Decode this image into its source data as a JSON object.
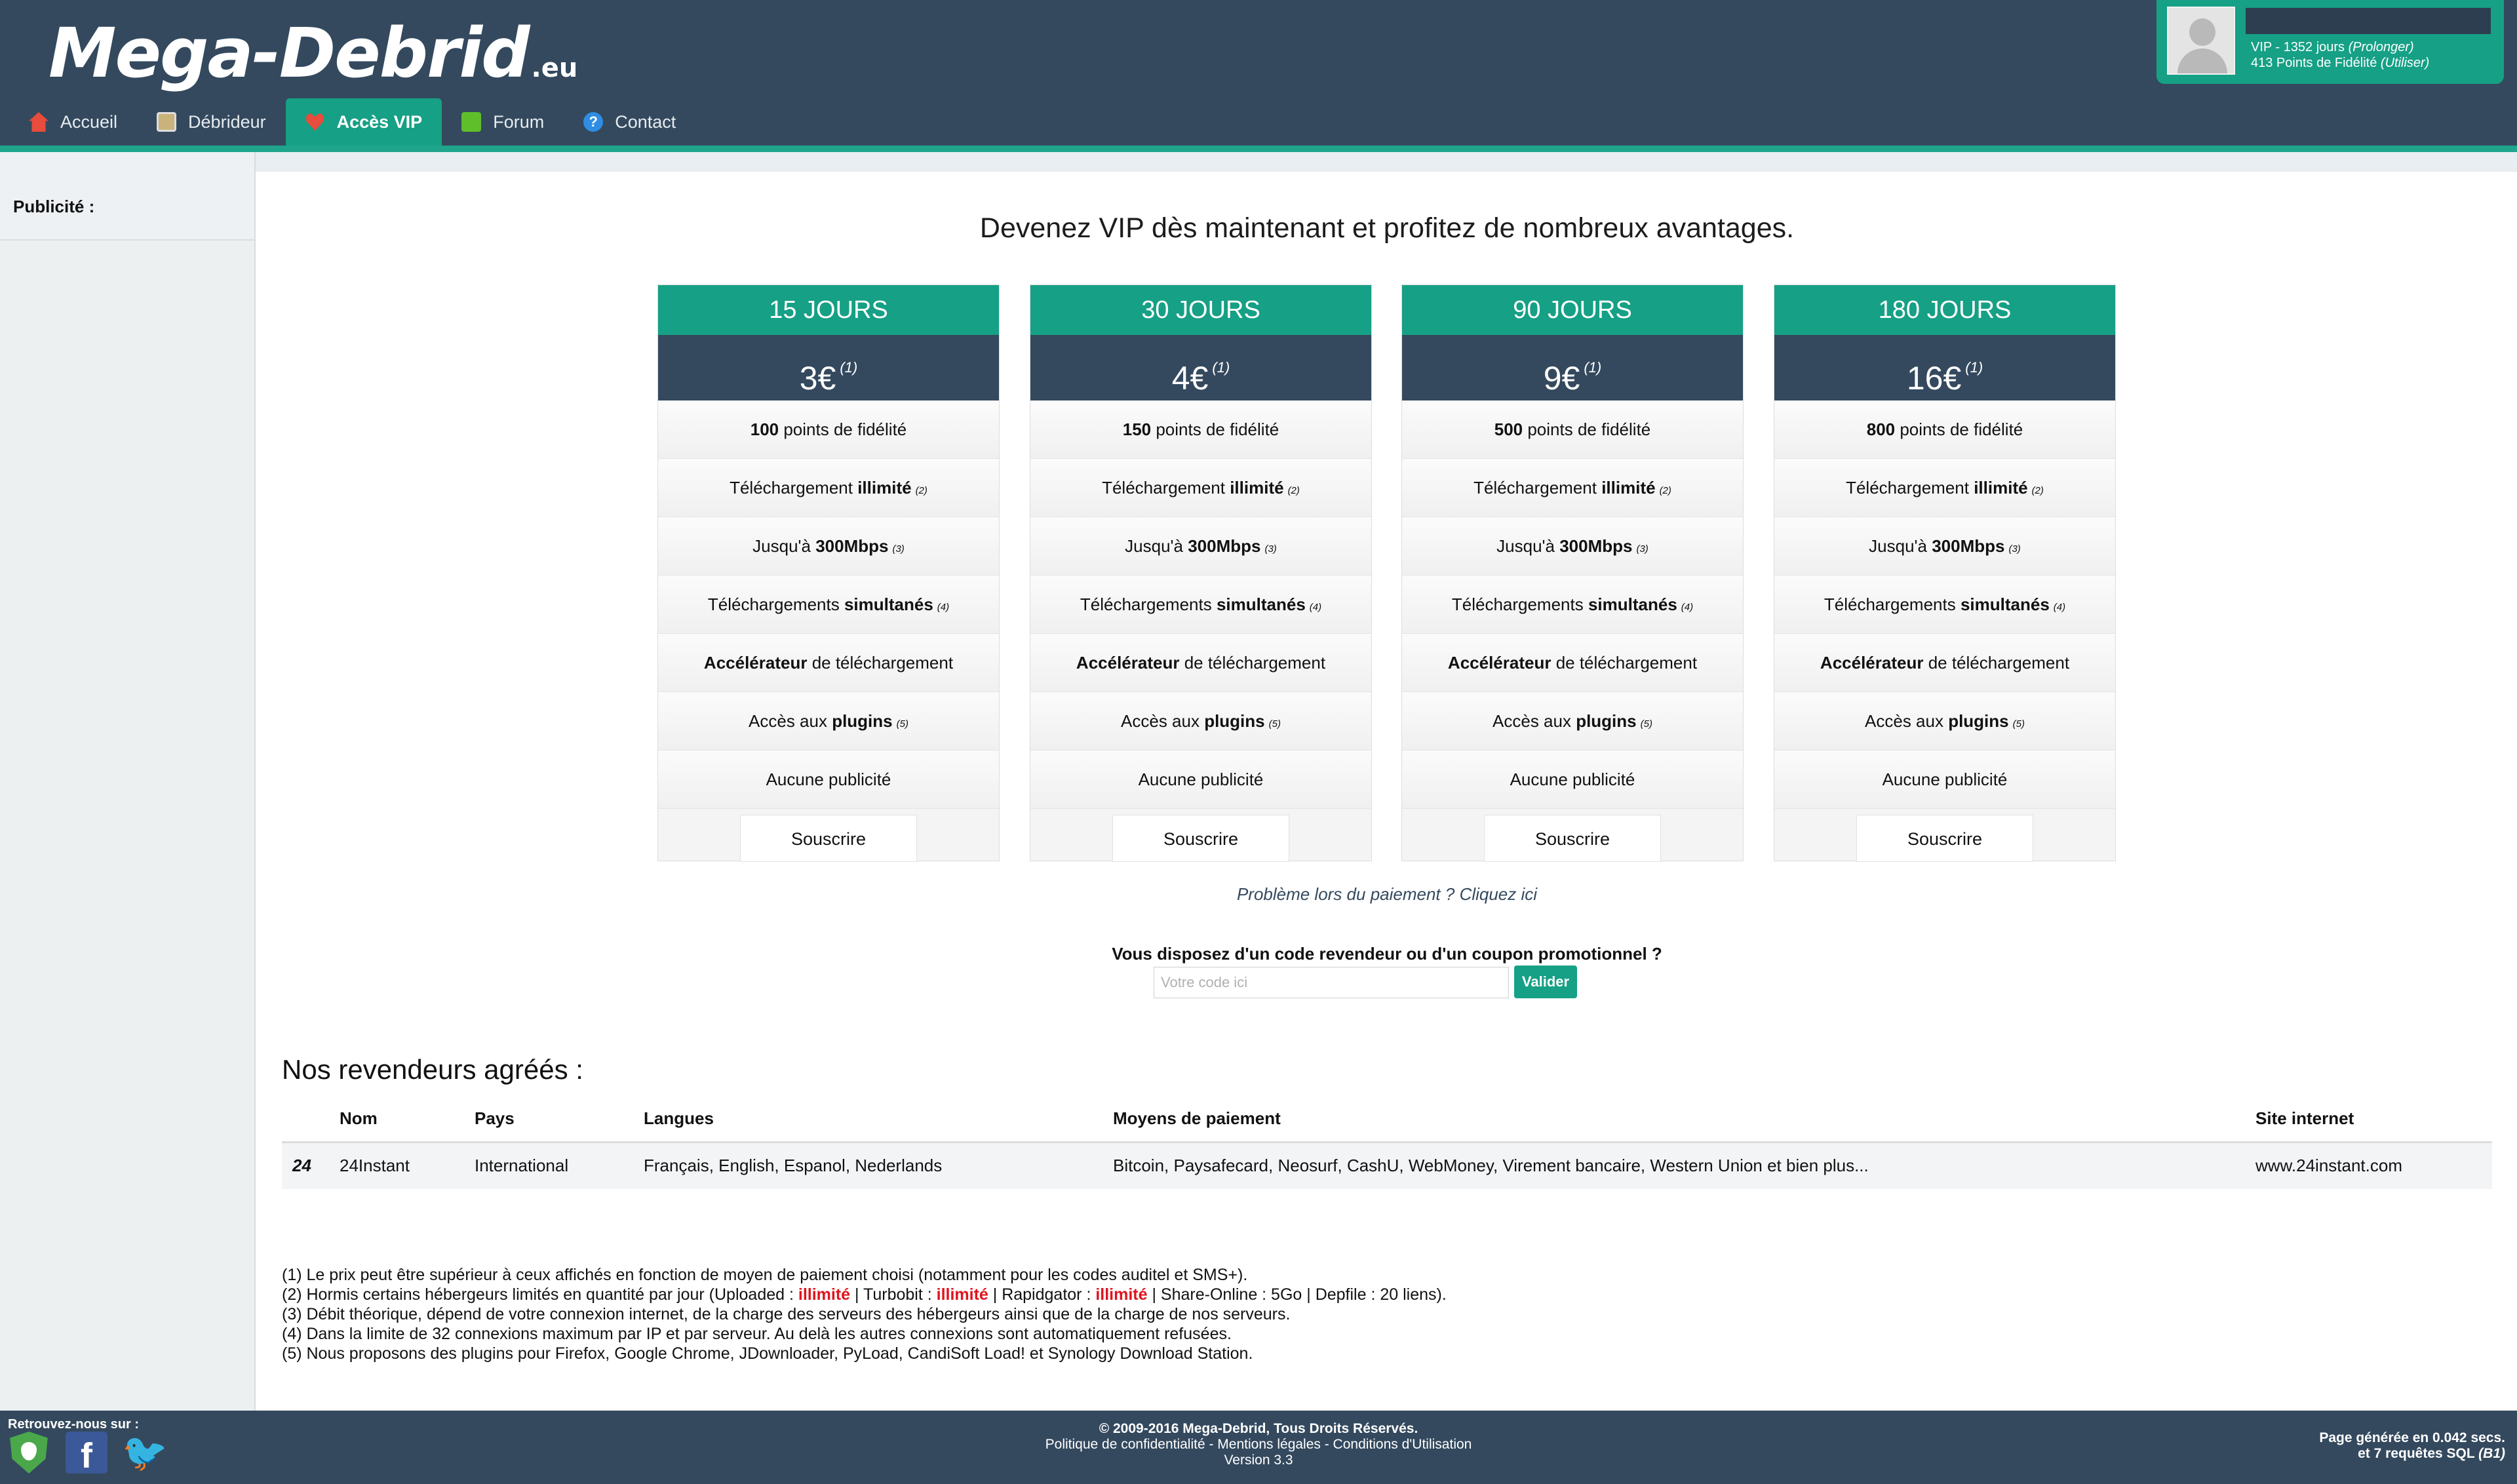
{
  "header": {
    "logo_main": "Mega-Debrid",
    "logo_tld": ".eu",
    "nav": [
      {
        "label": "Accueil",
        "icon": "home-icon"
      },
      {
        "label": "Débrideur",
        "icon": "debrideur-icon"
      },
      {
        "label": "Accès VIP",
        "icon": "heart-icon"
      },
      {
        "label": "Forum",
        "icon": "forum-icon"
      },
      {
        "label": "Contact",
        "icon": "help-icon"
      }
    ],
    "active_nav": "Accès VIP"
  },
  "user": {
    "vip_prefix": "VIP - 1352 jours ",
    "vip_link": "(Prolonger)",
    "points_prefix": "413 Points de Fidélité ",
    "points_link": "(Utiliser)"
  },
  "sidebar": {
    "ad_label": "Publicité :"
  },
  "main": {
    "headline": "Devenez VIP dès maintenant et profitez de nombreux avantages.",
    "plans": [
      {
        "title": "15 JOURS",
        "price": "3€",
        "price_note": "(1)",
        "points_value": "100"
      },
      {
        "title": "30 JOURS",
        "price": "4€",
        "price_note": "(1)",
        "points_value": "150"
      },
      {
        "title": "90 JOURS",
        "price": "9€",
        "price_note": "(1)",
        "points_value": "500"
      },
      {
        "title": "180 JOURS",
        "price": "16€",
        "price_note": "(1)",
        "points_value": "800"
      }
    ],
    "features": {
      "points_suffix": " points de fidélité",
      "download_prefix": "Téléchargement ",
      "download_bold": "illimité",
      "download_note": "(2)",
      "speed_prefix": "Jusqu'à ",
      "speed_bold": "300Mbps",
      "speed_note": "(3)",
      "simul_prefix": "Téléchargements ",
      "simul_bold": "simultanés",
      "simul_note": "(4)",
      "accel_bold": "Accélérateur",
      "accel_suffix": " de téléchargement",
      "plugins_prefix": "Accès aux ",
      "plugins_bold": "plugins",
      "plugins_note": "(5)",
      "no_ads": "Aucune publicité",
      "subscribe": "Souscrire"
    },
    "payment_problem": "Problème lors du paiement ? Cliquez ici",
    "coupon_question": "Vous disposez d'un code revendeur ou d'un coupon promotionnel ?",
    "coupon_placeholder": "Votre code ici",
    "coupon_submit": "Valider",
    "resellers_title": "Nos revendeurs agréés :",
    "resellers_columns": [
      "Nom",
      "Pays",
      "Langues",
      "Moyens de paiement",
      "Site internet"
    ],
    "resellers_rows": [
      {
        "logo": "24",
        "name": "24Instant",
        "country": "International",
        "languages": "Français, English, Espanol, Nederlands",
        "payments": "Bitcoin, Paysafecard, Neosurf, CashU, WebMoney, Virement bancaire, Western Union et bien plus...",
        "site": "www.24instant.com"
      }
    ],
    "footnotes": {
      "n1": "(1) Le prix peut être supérieur à ceux affichés en fonction de moyen de paiement choisi (notamment pour les codes auditel et SMS+).",
      "n2_a": "(2) Hormis certains hébergeurs limités en quantité par jour (Uploaded : ",
      "n2_red1": "illimité",
      "n2_b": " | Turbobit : ",
      "n2_red2": "illimité",
      "n2_c": " | Rapidgator : ",
      "n2_red3": "illimité",
      "n2_d": " | Share-Online : 5Go | Depfile : 20 liens).",
      "n3": "(3) Débit théorique, dépend de votre connexion internet, de la charge des serveurs des hébergeurs ainsi que de la charge de nos serveurs.",
      "n4": "(4) Dans la limite de 32 connexions maximum par IP et par serveur. Au delà les autres connexions sont automatiquement refusées.",
      "n5": "(5) Nous proposons des plugins pour Firefox, Google Chrome, JDownloader, PyLoad, CandiSoft Load! et Synology Download Station."
    }
  },
  "footer": {
    "follow_label": "Retrouvez-nous sur :",
    "copyright": "© 2009-2016 Mega-Debrid, Tous Droits Réservés.",
    "links": "Politique de confidentialité - Mentions légales - Conditions d'Utilisation",
    "version": "Version 3.3",
    "gen_line1": "Page générée en 0.042 secs.",
    "gen_line2_prefix": "et 7 requêtes SQL ",
    "gen_line2_em": "(B1)",
    "social_icons": [
      "shield-icon",
      "facebook-icon",
      "twitter-icon"
    ]
  },
  "colors": {
    "header_bg": "#34495e",
    "accent": "#16a085",
    "footnote_red": "#e0141e"
  }
}
